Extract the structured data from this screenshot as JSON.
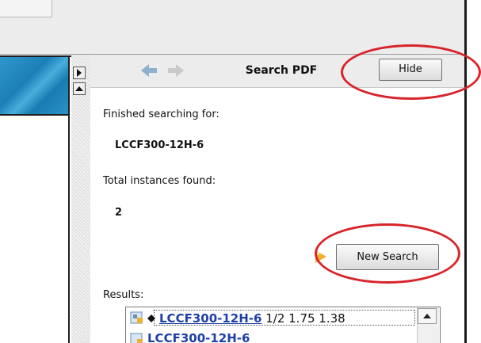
{
  "pane": {
    "title": "Search PDF",
    "hide_label": "Hide",
    "finished_label": "Finished searching for:",
    "search_term": "LCCF300-12H-6",
    "total_label": "Total instances found:",
    "total_count": "2",
    "new_search_label": "New Search",
    "results_label": "Results:"
  },
  "results": [
    {
      "link": "LCCF300-12H-6",
      "detail": " 1/2 1.75 1.38"
    },
    {
      "link": "LCCF300-12H-6",
      "detail": ""
    }
  ],
  "colors": {
    "annotation": "#d8242a",
    "link": "#1f3fa8",
    "banner": "#2f97cb"
  },
  "icons": {
    "back": "back-arrow-icon",
    "forward": "forward-arrow-icon",
    "search_go": "search-go-icon",
    "result": "pdf-result-icon",
    "bullet": "diamond-bullet-icon",
    "expand": "triangle-right-icon",
    "scroll_up": "triangle-up-icon"
  }
}
